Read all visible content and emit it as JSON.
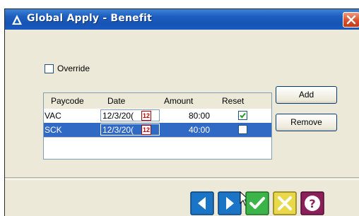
{
  "window": {
    "title": "Global Apply - Benefit"
  },
  "override": {
    "label": "Override",
    "checked": false
  },
  "grid": {
    "headers": {
      "paycode": "Paycode",
      "date": "Date",
      "amount": "Amount",
      "reset": "Reset"
    },
    "rows": [
      {
        "paycode": "VAC",
        "date": "12/3/20(",
        "amount": "80:00",
        "reset": true,
        "selected": false
      },
      {
        "paycode": "SCK",
        "date": "12/3/20(",
        "amount": "40:00",
        "reset": false,
        "selected": true
      }
    ]
  },
  "buttons": {
    "add": "Add",
    "remove": "Remove"
  },
  "calendar_icon_text": "12",
  "colors": {
    "title_bar": "#1f5fbf",
    "selection": "#316ac5",
    "nav_button": "#1a75c6",
    "ok_button": "#3bb54a",
    "cancel_button": "#e8d84a",
    "help_button": "#8a1f5a"
  }
}
